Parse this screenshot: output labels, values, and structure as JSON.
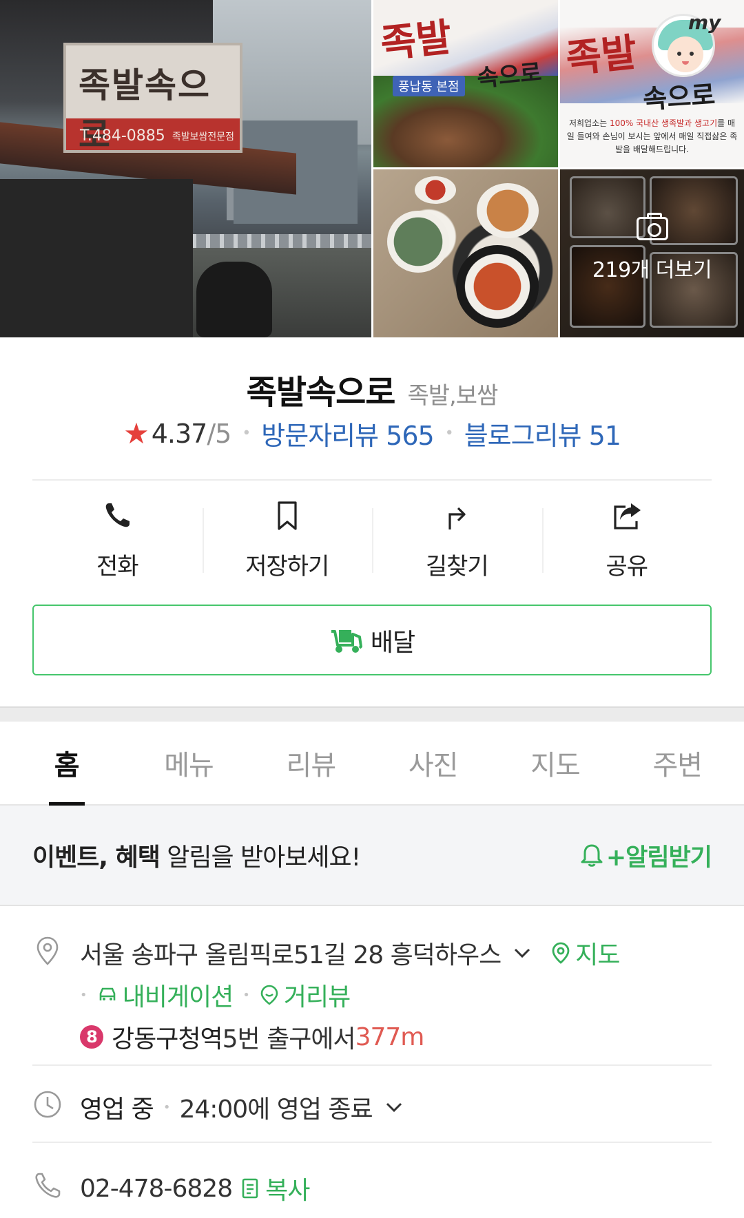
{
  "gallery": {
    "signboard_text": "족발속으로",
    "signboard_phone": "T.484-0885",
    "signboard_sub": "족발보쌈전문점",
    "photo1_title": "족발",
    "photo1_sub": "속으로",
    "photo1_tag": "풍납동 본점",
    "photo2_title": "족발",
    "photo2_sub": "속으로",
    "photo2_desc_1": "저희업소는 ",
    "photo2_desc_hl": "100% 국내산 생족발과 생고기",
    "photo2_desc_2": "를 매일 들여와 손님이 보시는 앞에서 매일 직접삶은 족발을 배달해드립니다.",
    "my_badge": "my",
    "more_label": "219개 더보기"
  },
  "place": {
    "name": "족발속으로",
    "category": "족발,보쌈",
    "rating": "4.37",
    "rating_max": "/5",
    "visitor_reviews": "방문자리뷰 565",
    "blog_reviews": "블로그리뷰 51"
  },
  "actions": {
    "call": "전화",
    "save": "저장하기",
    "directions": "길찾기",
    "share": "공유",
    "delivery": "배달"
  },
  "tabs": [
    "홈",
    "메뉴",
    "리뷰",
    "사진",
    "지도",
    "주변"
  ],
  "notice": {
    "bold": "이벤트, 혜택",
    "rest": " 알림을 받아보세요!",
    "action": "+알림받기"
  },
  "info": {
    "address": "서울 송파구 올림픽로51길 28 흥덕하우스",
    "map_link": "지도",
    "navigation_link": "내비게이션",
    "street_view_link": "거리뷰",
    "subway_line": "8",
    "subway_station": "강동구청역",
    "subway_exit": " 5번 출구에서 ",
    "subway_distance": "377m",
    "hours_status": "영업 중",
    "hours_detail": "24:00에 영업 종료",
    "phone": "02-478-6828",
    "copy_label": "복사"
  },
  "colors": {
    "accent_green": "#35b05a",
    "link_blue": "#2e67b8",
    "star_red": "#e5403b",
    "subway_line8": "#d9386b"
  }
}
